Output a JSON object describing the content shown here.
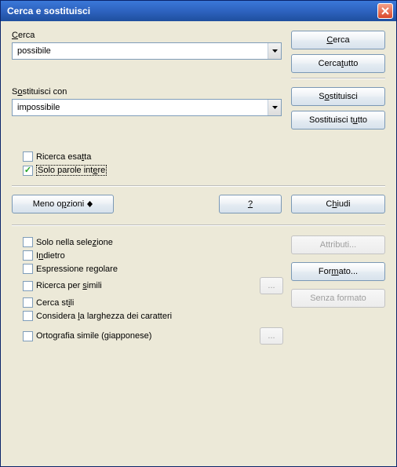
{
  "title": "Cerca e sostituisci",
  "search": {
    "label_pre": "",
    "label_u": "C",
    "label_post": "erca",
    "value": "possibile"
  },
  "replace": {
    "label_pre": "S",
    "label_u": "o",
    "label_post": "stituisci con",
    "value": "impossibile"
  },
  "buttons": {
    "find_pre": "",
    "find_u": "C",
    "find_post": "erca",
    "findall_pre": "Cerca ",
    "findall_u": "t",
    "findall_post": "utto",
    "replace_pre": "S",
    "replace_u": "o",
    "replace_post": "stituisci",
    "replaceall_pre": "Sostituisci t",
    "replaceall_u": "u",
    "replaceall_post": "tto",
    "less_pre": "Meno o",
    "less_u": "p",
    "less_post": "zioni",
    "help": "?",
    "close_pre": "C",
    "close_u": "h",
    "close_post": "iudi",
    "attributes": "Attributi...",
    "format_pre": "For",
    "format_u": "m",
    "format_post": "ato...",
    "noformat": "Senza formato",
    "ellipsis": "..."
  },
  "checks": {
    "exact_pre": "Ricerca esa",
    "exact_u": "t",
    "exact_post": "ta",
    "wholewords_pre": "Solo parole int",
    "wholewords_u": "e",
    "wholewords_post": "re",
    "inselection_pre": "Solo nella sele",
    "inselection_u": "z",
    "inselection_post": "ione",
    "back_pre": "I",
    "back_u": "n",
    "back_post": "dietro",
    "regex_pre": "Espressione re",
    "regex_u": "g",
    "regex_post": "olare",
    "similarity_pre": "Ricerca per ",
    "similarity_u": "s",
    "similarity_post": "imili",
    "styles_pre": "Cerca st",
    "styles_u": "i",
    "styles_post": "li",
    "charwidth_pre": "Considera ",
    "charwidth_u": "l",
    "charwidth_post": "a larghezza dei caratteri",
    "japanese_pre": "Ortografia simile (",
    "japanese_u": "g",
    "japanese_post": "iapponese)"
  }
}
